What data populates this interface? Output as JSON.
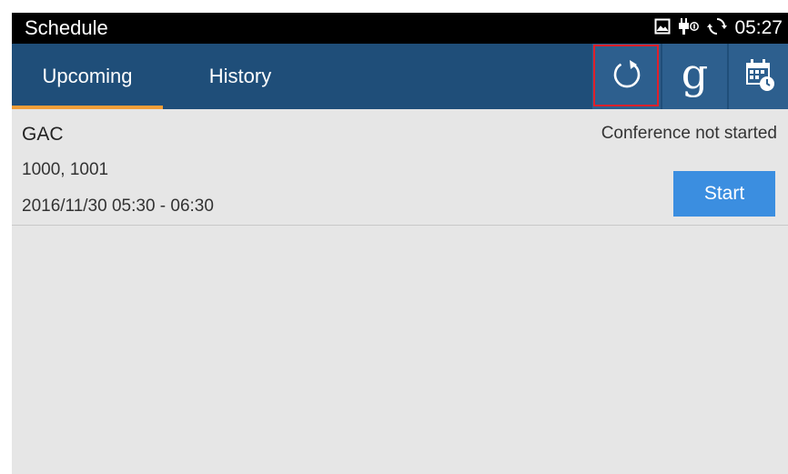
{
  "status_bar": {
    "app_title": "Schedule",
    "time": "05:27",
    "icons": [
      "image-icon",
      "usb-debug-icon",
      "sync-icon"
    ]
  },
  "tabs": [
    {
      "label": "Upcoming",
      "selected": true
    },
    {
      "label": "History",
      "selected": false
    }
  ],
  "actions": {
    "refresh_icon": "refresh-icon",
    "google_icon": "google-g-icon",
    "google_glyph": "g",
    "calendar_icon": "calendar-clock-icon"
  },
  "meetings": [
    {
      "title": "GAC",
      "participants": "1000, 1001",
      "time_range": "2016/11/30 05:30 - 06:30",
      "status": "Conference not started",
      "action_label": "Start"
    }
  ],
  "colors": {
    "toolbar": "#1f4e79",
    "tab_indicator": "#f29e38",
    "start_button": "#3b8ee0",
    "highlight": "#e0202a"
  }
}
